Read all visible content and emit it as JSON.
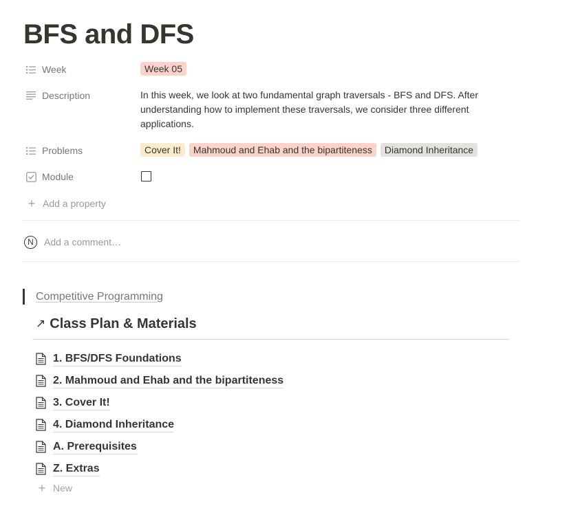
{
  "page": {
    "title": "BFS and DFS"
  },
  "properties": {
    "week": {
      "label": "Week",
      "icon": "list-icon",
      "value": "Week 05",
      "color": "#fbd3cb"
    },
    "description": {
      "label": "Description",
      "icon": "text-lines-icon",
      "value": "In this week, we look at two fundamental graph traversals - BFS and DFS. After understanding how to implement these traversals, we consider three different applications."
    },
    "problems": {
      "label": "Problems",
      "icon": "list-icon",
      "tags": [
        {
          "label": "Cover It!",
          "color": "#fbeccd"
        },
        {
          "label": "Mahmoud and Ehab and the bipartiteness",
          "color": "#fbd3cb"
        },
        {
          "label": "Diamond Inheritance",
          "color": "#e3e2e0"
        }
      ]
    },
    "module": {
      "label": "Module",
      "icon": "checkbox-icon",
      "checked": false
    },
    "add_property_label": "Add a property"
  },
  "comment": {
    "avatar_letter": "N",
    "placeholder": "Add a comment…"
  },
  "content": {
    "parent_link": "Competitive Programming",
    "section_heading": "Class Plan & Materials",
    "pages": [
      "1. BFS/DFS Foundations",
      "2. Mahmoud and Ehab and the bipartiteness",
      "3. Cover It!",
      "4. Diamond Inheritance",
      "A. Prerequisites",
      "Z. Extras"
    ],
    "new_label": "New"
  },
  "colors": {
    "text": "#37352f",
    "muted": "#787774",
    "placeholder": "#9b9a97"
  }
}
